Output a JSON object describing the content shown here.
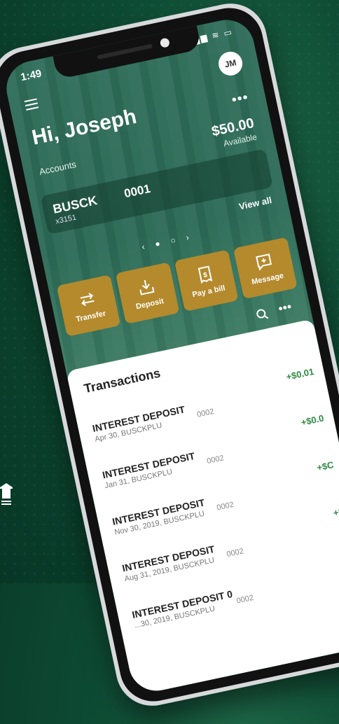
{
  "status": {
    "time": "1:49",
    "icons": "▂▄▆ ≋ ▭"
  },
  "header": {
    "avatar_initials": "JM",
    "greeting": "Hi, Joseph",
    "more": "•••"
  },
  "accounts": {
    "label": "Accounts",
    "balance": "$50.00",
    "balance_caption": "Available",
    "account_name": "BUSCK",
    "account_sub": "x3151",
    "account_number": "0001",
    "view_all": "View all",
    "pager": "‹ ● ○ ›"
  },
  "actions": [
    {
      "label": "Transfer",
      "icon": "transfer-icon"
    },
    {
      "label": "Deposit",
      "icon": "deposit-icon"
    },
    {
      "label": "Pay a bill",
      "icon": "bill-icon"
    },
    {
      "label": "Message",
      "icon": "message-icon"
    }
  ],
  "transactions": {
    "title": "Transactions",
    "more": "•••",
    "items": [
      {
        "title": "INTEREST DEPOSIT",
        "sub": "Apr 30, BUSCKPLU",
        "code": "0002",
        "amount": "+$0.01"
      },
      {
        "title": "INTEREST DEPOSIT",
        "sub": "Jan 31, BUSCKPLU",
        "code": "0002",
        "amount": "+$0.0"
      },
      {
        "title": "INTEREST DEPOSIT",
        "sub": "Nov 30, 2019, BUSCKPLU",
        "code": "0002",
        "amount": "+$C"
      },
      {
        "title": "INTEREST DEPOSIT",
        "sub": "Aug 31, 2019, BUSCKPLU",
        "code": "0002",
        "amount": "+$"
      },
      {
        "title": "INTEREST DEPOSIT 0",
        "sub": "...30, 2019, BUSCKPLU",
        "code": "0002",
        "amount": ""
      }
    ]
  },
  "colors": {
    "accent_gold": "#b48a2d",
    "positive_green": "#2f8a42",
    "bg_green": "#0d4a33"
  }
}
